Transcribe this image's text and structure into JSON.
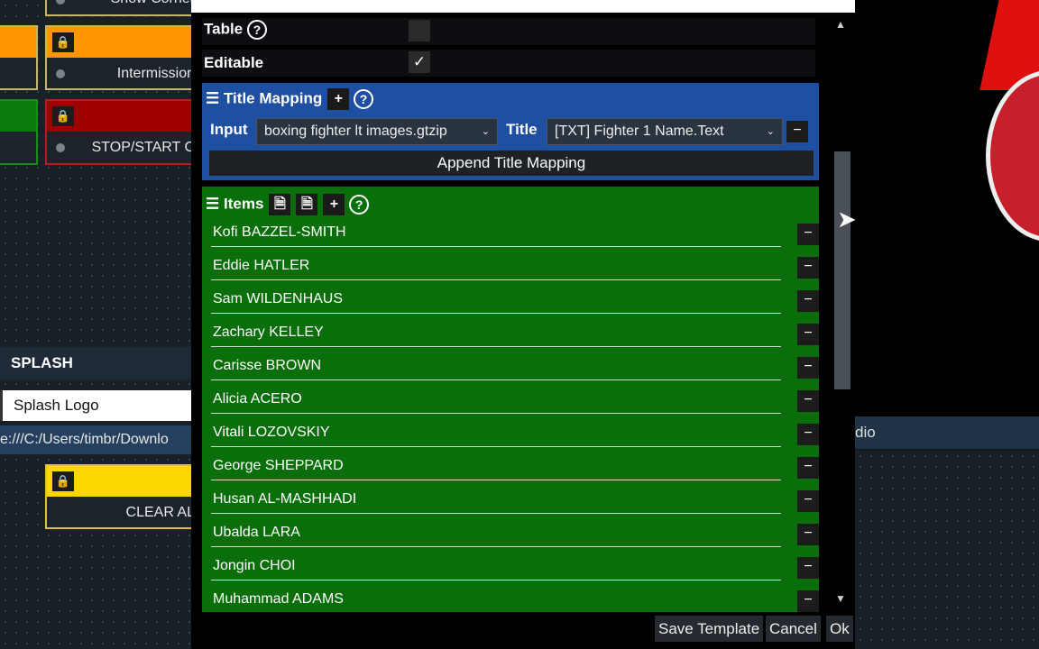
{
  "background": {
    "tiles": [
      {
        "label": "Show Corner",
        "color": "#c8b46a"
      },
      {
        "label": "Intermission",
        "color": "#ff9500"
      },
      {
        "label": "STOP/START C",
        "color": "#a00000"
      },
      {
        "label": "CLEAR AL",
        "color": "#ffd700"
      }
    ],
    "splash_header": "SPLASH",
    "splash_input": "Splash Logo",
    "splash_path": "e:///C:/Users/timbr/Downlo",
    "right_header": "dio"
  },
  "dialog": {
    "table_label": "Table",
    "table_checked": false,
    "editable_label": "Editable",
    "editable_checked": true,
    "check_glyph": "✓",
    "title_mapping": {
      "label": "Title Mapping",
      "color": "#1e4fa0",
      "input_label": "Input",
      "input_value": "boxing fighter lt images.gtzip",
      "title_label": "Title",
      "title_value": "[TXT] Fighter 1 Name.Text",
      "append_label": "Append Title Mapping"
    },
    "items": {
      "label": "Items",
      "color": "#0a6e0a",
      "list": [
        "Kofi BAZZEL-SMITH",
        "Eddie HATLER",
        "Sam WILDENHAUS",
        "Zachary KELLEY",
        "Carisse BROWN",
        "Alicia ACERO",
        "Vitali LOZOVSKIY",
        "George SHEPPARD",
        "Husan AL-MASHHADI",
        "Ubalda LARA",
        "Jongin CHOI",
        "Muhammad ADAMS"
      ]
    },
    "footer": {
      "save": "Save Template",
      "cancel": "Cancel",
      "ok": "Ok"
    }
  }
}
